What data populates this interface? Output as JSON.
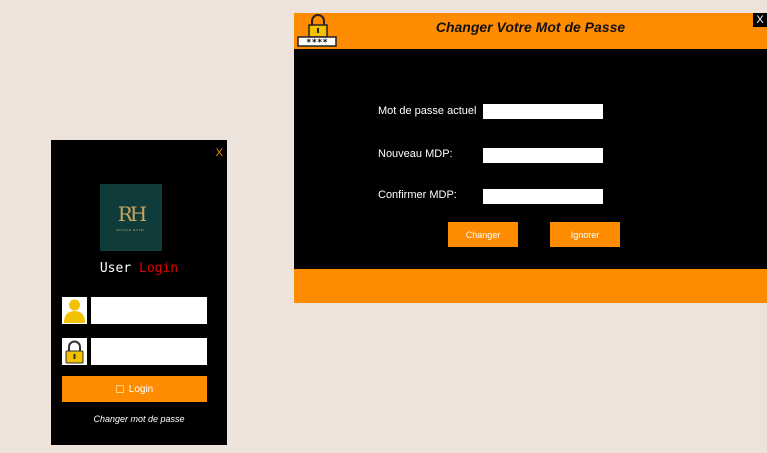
{
  "login": {
    "close_label": "X",
    "logo_text": "RH",
    "logo_subtext": "ROYALE HOTEL",
    "title_word1": "User",
    "title_word2": "Login",
    "username_icon": "user-icon",
    "password_icon": "lock-icon",
    "username_value": "",
    "password_value": "",
    "login_button_label": "Login",
    "change_password_link": "Changer mot de passe"
  },
  "change_password": {
    "title": "Changer Votre Mot de Passe",
    "close_label": "X",
    "badge_text": "****",
    "current_label": "Mot de passe actuel",
    "new_label": "Nouveau MDP:",
    "confirm_label": "Confirmer MDP:",
    "current_value": "",
    "new_value": "",
    "confirm_value": "",
    "change_button": "Changer",
    "ignore_button": "Ignorer"
  },
  "colors": {
    "accent": "#ff8c00",
    "window_bg": "#000000",
    "desktop_bg": "#ede3da",
    "login_red": "#e00000"
  }
}
